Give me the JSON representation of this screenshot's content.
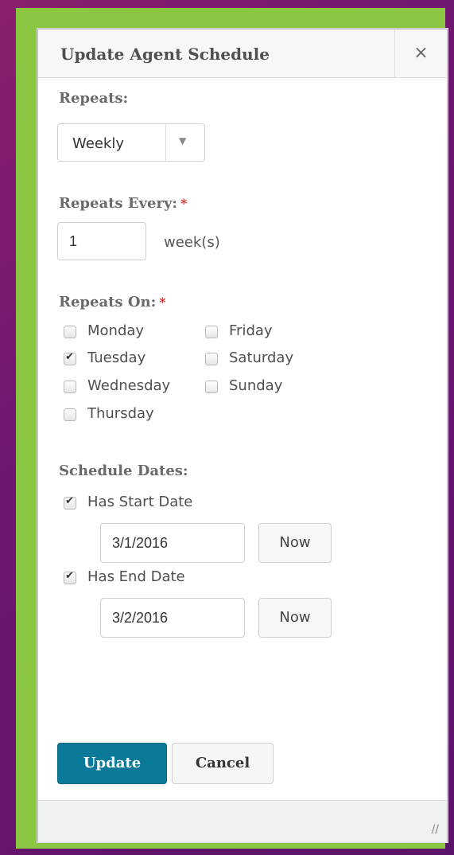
{
  "dialog": {
    "title": "Update Agent Schedule",
    "close_label": "×"
  },
  "repeats": {
    "label": "Repeats:",
    "selected": "Weekly",
    "arrow": "▼"
  },
  "repeats_every": {
    "label": "Repeats Every:",
    "required_mark": "*",
    "value": "1",
    "unit": "week(s)"
  },
  "repeats_on": {
    "label": "Repeats On:",
    "required_mark": "*",
    "days": [
      {
        "label": "Monday",
        "checked": false
      },
      {
        "label": "Tuesday",
        "checked": true
      },
      {
        "label": "Wednesday",
        "checked": false
      },
      {
        "label": "Thursday",
        "checked": false
      },
      {
        "label": "Friday",
        "checked": false
      },
      {
        "label": "Saturday",
        "checked": false
      },
      {
        "label": "Sunday",
        "checked": false
      }
    ]
  },
  "schedule_dates": {
    "label": "Schedule Dates:",
    "start": {
      "label": "Has Start Date",
      "checked": true,
      "value": "3/1/2016",
      "now_label": "Now"
    },
    "end": {
      "label": "Has End Date",
      "checked": true,
      "value": "3/2/2016",
      "now_label": "Now"
    }
  },
  "actions": {
    "update_label": "Update",
    "cancel_label": "Cancel"
  },
  "footer": {
    "resize_glyph": "//"
  }
}
